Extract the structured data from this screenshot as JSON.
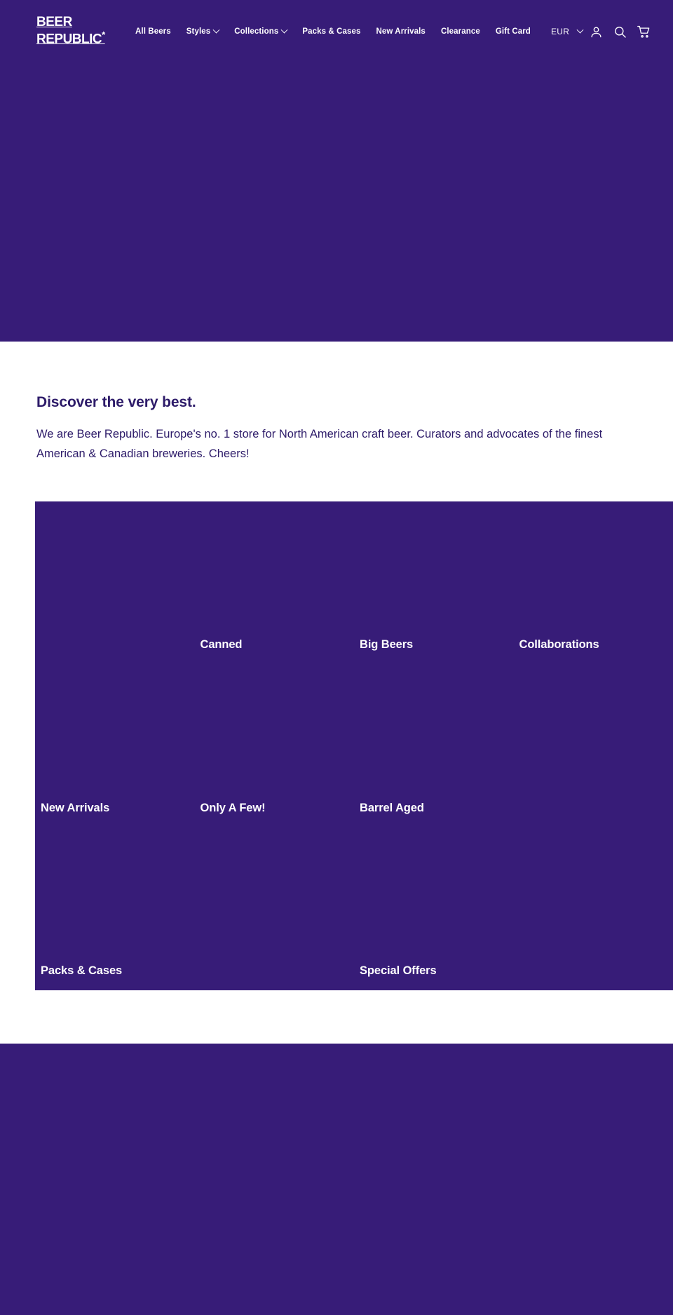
{
  "brand": {
    "logo_line1": "BEER",
    "logo_line2": "REPUBLIC",
    "logo_mark": "*",
    "accent_purple": "#371c78",
    "text_purple": "#2d1b69",
    "white": "#ffffff"
  },
  "nav": {
    "items": [
      {
        "label": "All Beers",
        "has_dropdown": false
      },
      {
        "label": "Styles",
        "has_dropdown": true
      },
      {
        "label": "Collections",
        "has_dropdown": true
      },
      {
        "label": "Packs & Cases",
        "has_dropdown": false
      },
      {
        "label": "New Arrivals",
        "has_dropdown": false
      },
      {
        "label": "Clearance",
        "has_dropdown": false
      },
      {
        "label": "Gift Card",
        "has_dropdown": false
      }
    ],
    "currency": "EUR",
    "account_icon": "account-icon",
    "search_icon": "search-icon",
    "cart_icon": "cart-icon"
  },
  "intro": {
    "title": "Discover the very best.",
    "body": "We are Beer Republic. Europe's no. 1 store for North American craft beer. Curators and advocates of the finest American & Canadian breweries. Cheers!"
  },
  "grid": {
    "tiles": [
      {
        "label": "",
        "empty": true
      },
      {
        "label": "Canned",
        "empty": false
      },
      {
        "label": "Big Beers",
        "empty": false
      },
      {
        "label": "Collaborations",
        "empty": false
      },
      {
        "label": "New Arrivals",
        "empty": false
      },
      {
        "label": "Only A Few!",
        "empty": false
      },
      {
        "label": "Barrel Aged",
        "empty": false
      },
      {
        "label": "",
        "empty": true
      },
      {
        "label": "Packs & Cases",
        "empty": false
      },
      {
        "label": "",
        "empty": true
      },
      {
        "label": "Special Offers",
        "empty": false
      },
      {
        "label": "",
        "empty": true
      }
    ]
  }
}
